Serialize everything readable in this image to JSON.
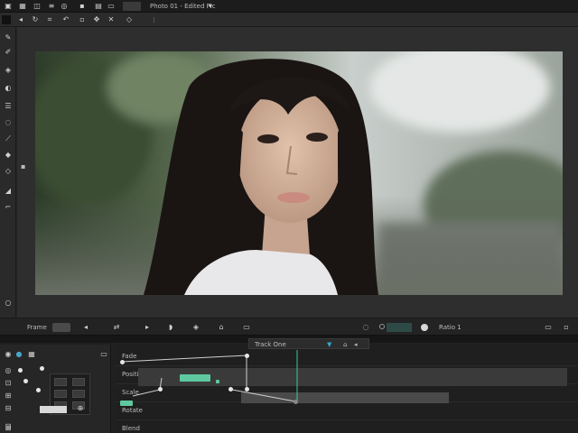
{
  "menubar": {
    "title": "Photo 01 - Edited Pic",
    "icons": [
      "square-icon",
      "grid-icon",
      "split-icon",
      "circle-icon",
      "trash-icon",
      "menu-icon",
      "image-icon",
      "window-icon"
    ]
  },
  "options_bar": {
    "icons": [
      "square-icon",
      "arrow-icon",
      "refresh-icon",
      "crop-icon",
      "undo-icon",
      "lock-icon",
      "move-icon",
      "zoom-icon",
      "snap-icon"
    ]
  },
  "toolbox": {
    "tools": [
      "pen-icon",
      "brush-icon",
      "layers-icon",
      "clone-icon",
      "sliders-icon",
      "lasso-icon",
      "eyedropper-icon",
      "fill-icon",
      "shape-icon",
      "eraser-icon",
      "crop-tool-icon",
      "layer-toggle-icon"
    ]
  },
  "canvas": {
    "description_label": "",
    "colors": {
      "bg_top": "#dfe3e2",
      "bg_left": "#3f5238",
      "hair": "#1a1513",
      "skin": "#d9b8a1",
      "shirt": "#e8e8ea"
    }
  },
  "playbar": {
    "left_label": "Frame",
    "right_label": "Ratio 1"
  },
  "timeline": {
    "header_label": "Track One",
    "rows": [
      "Fade",
      "Position",
      "Scale",
      "Rotate",
      "Blend"
    ],
    "playhead_color": "#35c9a6",
    "key_color": "#5fc8a0"
  }
}
